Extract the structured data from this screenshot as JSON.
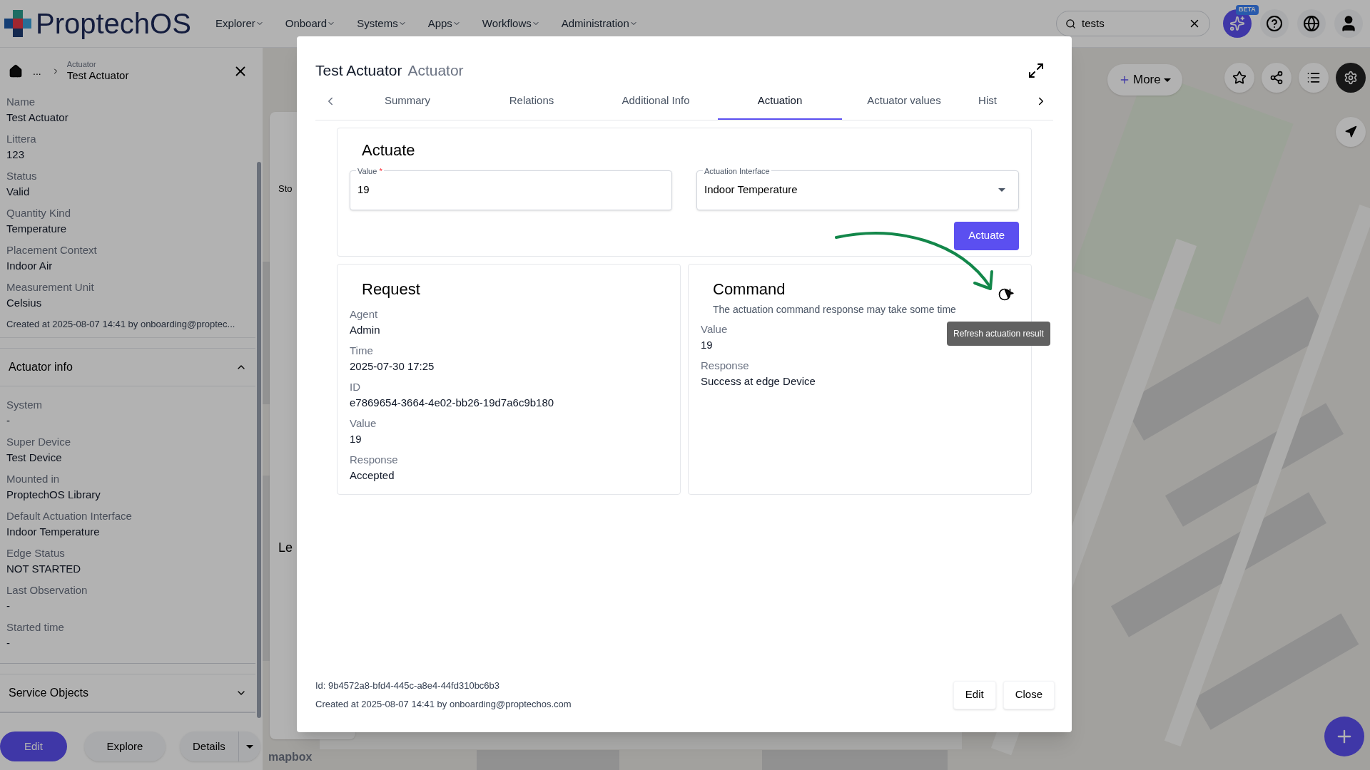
{
  "topbar": {
    "logo": "ProptechOS",
    "nav": [
      "Explorer",
      "Onboard",
      "Systems",
      "Apps",
      "Workflows",
      "Administration"
    ],
    "search": {
      "value": "tests"
    },
    "beta_badge": "BETA"
  },
  "sidebar": {
    "breadcrumb": {
      "ellipsis": "...",
      "type": "Actuator",
      "name": "Test Actuator"
    },
    "fields": [
      {
        "label": "Name",
        "value": "Test Actuator"
      },
      {
        "label": "Littera",
        "value": "123"
      },
      {
        "label": "Status",
        "value": "Valid"
      },
      {
        "label": "Quantity Kind",
        "value": "Temperature"
      },
      {
        "label": "Placement Context",
        "value": "Indoor Air"
      },
      {
        "label": "Measurement Unit",
        "value": "Celsius"
      }
    ],
    "created": "Created at 2025-08-07 14:41 by onboarding@proptec...",
    "sections": [
      {
        "title": "Actuator info",
        "expanded": true,
        "fields": [
          {
            "label": "System",
            "value": "-"
          },
          {
            "label": "Super Device",
            "value": "Test Device"
          },
          {
            "label": "Mounted in",
            "value": "ProptechOS Library"
          },
          {
            "label": "Default Actuation Interface",
            "value": "Indoor Temperature"
          },
          {
            "label": "Edge Status",
            "value": "NOT STARTED"
          },
          {
            "label": "Last Observation",
            "value": "-"
          },
          {
            "label": "Started time",
            "value": "-"
          }
        ]
      },
      {
        "title": "Service Objects",
        "expanded": false
      }
    ],
    "buttons": {
      "edit": "Edit",
      "explore": "Explore",
      "details": "Details"
    }
  },
  "background_card": {
    "texts": [
      "Sto",
      "Le"
    ]
  },
  "map": {
    "more_button": "More",
    "attribution": "mapbox"
  },
  "modal": {
    "title": "Test Actuator",
    "type": "Actuator",
    "tabs": [
      {
        "label": "Summary",
        "selected": false
      },
      {
        "label": "Relations",
        "selected": false
      },
      {
        "label": "Additional Info",
        "selected": false
      },
      {
        "label": "Actuation",
        "selected": true
      },
      {
        "label": "Actuator values",
        "selected": false
      },
      {
        "label": "Hist",
        "selected": false
      }
    ],
    "actuate": {
      "title": "Actuate",
      "value_field": {
        "label": "Value",
        "required_mark": "*",
        "value": "19"
      },
      "interface_field": {
        "label": "Actuation Interface",
        "value": "Indoor Temperature"
      },
      "button": "Actuate"
    },
    "request": {
      "title": "Request",
      "fields": [
        {
          "label": "Agent",
          "value": "Admin"
        },
        {
          "label": "Time",
          "value": "2025-07-30 17:25"
        },
        {
          "label": "ID",
          "value": "e7869654-3664-4e02-bb26-19d7a6c9b180"
        },
        {
          "label": "Value",
          "value": "19"
        },
        {
          "label": "Response",
          "value": "Accepted"
        }
      ]
    },
    "command": {
      "title": "Command",
      "note": "The actuation command response may take some time",
      "fields": [
        {
          "label": "Value",
          "value": "19"
        },
        {
          "label": "Response",
          "value": "Success at edge Device"
        }
      ],
      "tooltip": "Refresh actuation result"
    },
    "footer": {
      "id": "Id: 9b4572a8-bfd4-445c-a8e4-44fd310bc6b3",
      "created": "Created at 2025-08-07 14:41 by onboarding@proptechos.com",
      "buttons": [
        "Edit",
        "Close"
      ]
    }
  }
}
